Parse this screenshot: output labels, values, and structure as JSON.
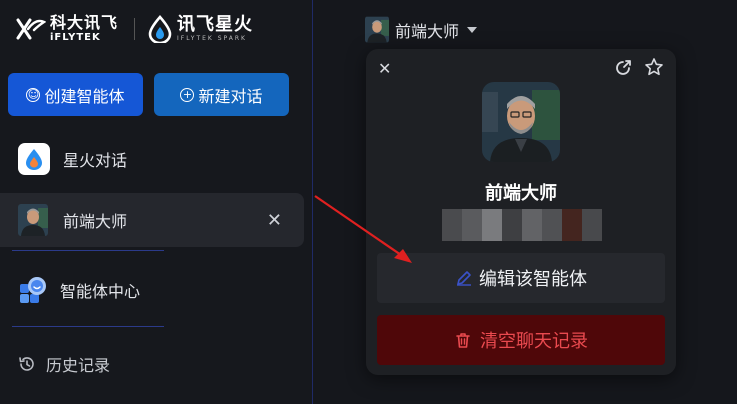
{
  "brand": {
    "iflytek_cn": "科大讯飞",
    "iflytek_en": "iFLYTEK",
    "spark_cn": "讯飞星火",
    "spark_en": "IFLYTEK SPARK"
  },
  "sidebar": {
    "create_agent_label": "创建智能体",
    "new_chat_label": "新建对话",
    "items": [
      {
        "label": "星火对话",
        "icon": "spark-chat-icon"
      },
      {
        "label": "前端大师",
        "icon": "agent-avatar"
      },
      {
        "label": "智能体中心",
        "icon": "agent-hub-icon"
      },
      {
        "label": "历史记录",
        "icon": "history-icon"
      }
    ]
  },
  "header": {
    "agent_name": "前端大师"
  },
  "agent_card": {
    "name": "前端大师",
    "edit_label": "编辑该智能体",
    "clear_label": "清空聊天记录"
  },
  "colors": {
    "primary_blue": "#1557d6",
    "secondary_blue": "#1466bd",
    "danger_bg": "#4f0709",
    "danger_text": "#ea4a4f",
    "annotation_arrow": "#e02020"
  }
}
